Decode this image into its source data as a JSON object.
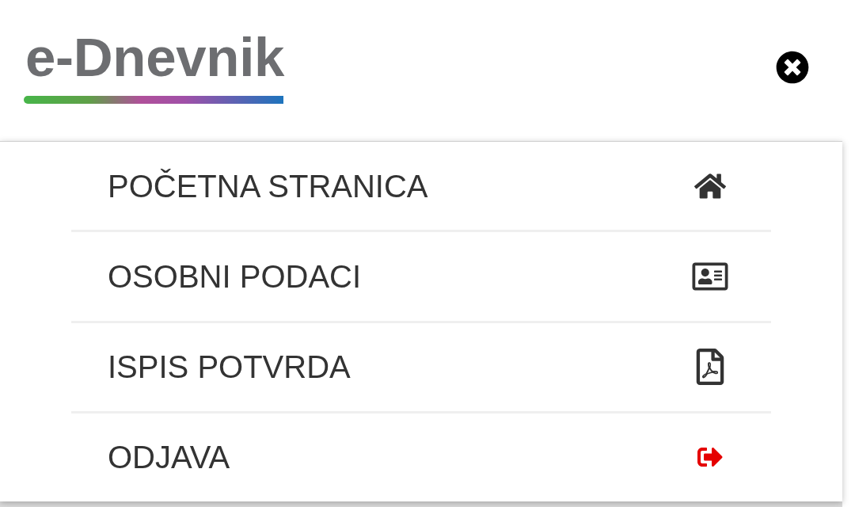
{
  "logo": {
    "text": "e-Dnevnik"
  },
  "menu": {
    "items": [
      {
        "label": "POČETNA STRANICA",
        "kind": "home"
      },
      {
        "label": "OSOBNI PODACI",
        "kind": "id-card"
      },
      {
        "label": "ISPIS POTVRDA",
        "kind": "pdf"
      },
      {
        "label": "ODJAVA",
        "kind": "logout"
      }
    ]
  }
}
